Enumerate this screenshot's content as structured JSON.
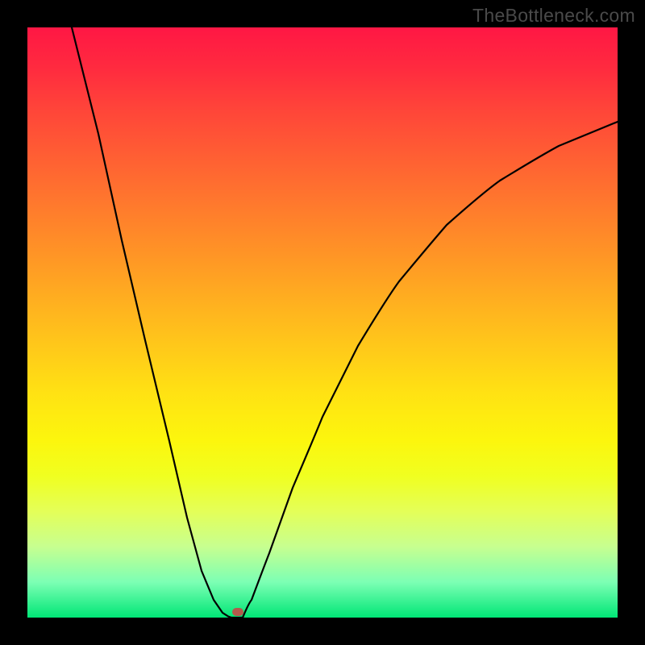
{
  "watermark": "TheBottleneck.com",
  "chart_data": {
    "type": "line",
    "title": "",
    "xlabel": "",
    "ylabel": "",
    "xlim": [
      0,
      100
    ],
    "ylim": [
      0,
      100
    ],
    "grid": false,
    "legend": false,
    "annotations": [],
    "series": [
      {
        "name": "left-branch",
        "x": [
          7.5,
          12,
          16,
          20,
          24,
          27,
          29.5,
          31.5,
          33,
          34,
          34.6
        ],
        "y": [
          100,
          82,
          64,
          47,
          30,
          17,
          8,
          3,
          0.8,
          0.2,
          0
        ]
      },
      {
        "name": "right-branch",
        "x": [
          36.5,
          38,
          41,
          45,
          50,
          56,
          63,
          71,
          80,
          90,
          100
        ],
        "y": [
          0,
          3,
          11,
          22,
          34,
          46,
          57,
          66.5,
          74,
          80,
          84
        ]
      }
    ],
    "marker": {
      "x": 35.5,
      "y": 0,
      "color": "#b35a4c"
    },
    "gradient_colors": [
      "#ff1744",
      "#ff9326",
      "#ffe213",
      "#00e676"
    ]
  }
}
